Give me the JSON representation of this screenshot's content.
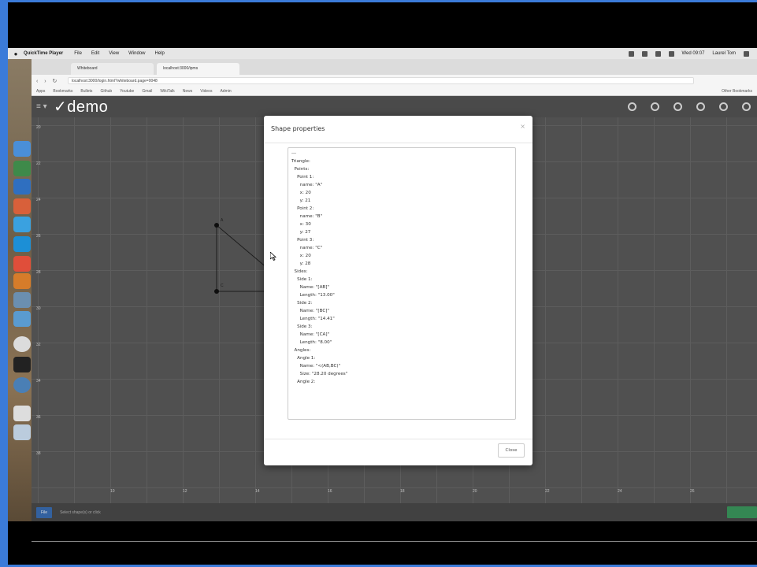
{
  "menubar": {
    "app_name": "QuickTime Player",
    "items": [
      "File",
      "Edit",
      "View",
      "Window",
      "Help"
    ],
    "clock": "Wed 09:07",
    "user": "Laurel Tom"
  },
  "browser": {
    "tabs": [
      "Whiteboard",
      "localhost:3000/ipms"
    ],
    "url": "localhost:3000/login.html?whiteboard.page=0048",
    "bookmarks": [
      "Apps",
      "Bookmarks",
      "Bullets",
      "Github",
      "Youtube",
      "Gmail",
      "WikiTalk",
      "News",
      "Videos",
      "Admin"
    ],
    "other_bookmarks": "Other Bookmarks"
  },
  "app": {
    "logo": "✓demo",
    "menu_icon": "hamburger-icon",
    "toolbar_icons": [
      "undo-icon",
      "redo-icon",
      "home-icon",
      "settings-icon",
      "help-icon",
      "share-icon"
    ],
    "file_button": "File",
    "status_text": "Select shape(s) or click"
  },
  "modal": {
    "title": "Shape properties",
    "close_x": "×",
    "close_label": "Close",
    "properties_text": [
      "---",
      "Triangle:",
      "  Points:",
      "    Point 1:",
      "      name: \"A\"",
      "      x: 20",
      "      y: 21",
      "    Point 2:",
      "      name: \"B\"",
      "      x: 30",
      "      y: 27",
      "    Point 3:",
      "      name: \"C\"",
      "      x: 20",
      "      y: 28",
      "  Sides:",
      "    Side 1:",
      "      Name: \"[AB]\"",
      "      Length: \"13.00\"",
      "    Side 2:",
      "      Name: \"[BC]\"",
      "      Length: \"14.41\"",
      "    Side 3:",
      "      Name: \"[CA]\"",
      "      Length: \"8.00\"",
      "  Angles:",
      "    Angle 1:",
      "      Name: \"<(AB,BC)\"",
      "      Size: \"28.20 degrees\"",
      "    Angle 2:"
    ]
  },
  "canvas": {
    "y_labels": [
      "20",
      "22",
      "24",
      "26",
      "28",
      "30",
      "32",
      "34",
      "36",
      "38"
    ],
    "x_labels": [
      "10",
      "12",
      "14",
      "16",
      "18",
      "20",
      "22",
      "24",
      "26"
    ],
    "point_labels": [
      "A",
      "C"
    ]
  }
}
